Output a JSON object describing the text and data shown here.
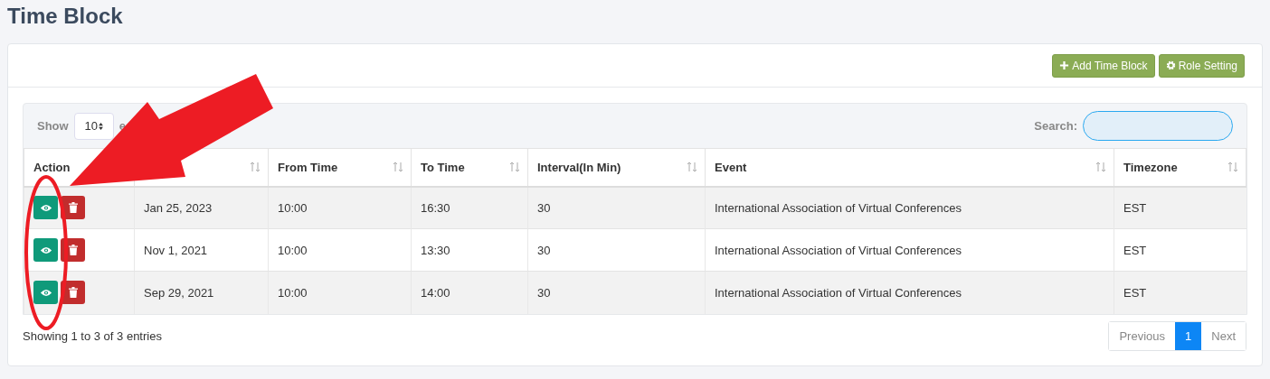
{
  "page": {
    "title": "Time Block"
  },
  "toolbar": {
    "buttons": [
      {
        "kind": "add",
        "label": "Add Time Block"
      },
      {
        "kind": "settings",
        "label": "Role Setting"
      }
    ]
  },
  "length_control": {
    "label": "Show",
    "value": "10",
    "suffix": "e"
  },
  "search": {
    "label": "Search:"
  },
  "table": {
    "columns": [
      {
        "label": "Action"
      },
      {
        "sortable": true
      },
      {
        "label": "From Time",
        "sortable": true
      },
      {
        "label": "To Time",
        "sortable": true
      },
      {
        "label": "Interval(In Min)",
        "sortable": true
      },
      {
        "label": "Event",
        "sortable": true
      },
      {
        "label": "Timezone",
        "sortable": true
      }
    ],
    "rows": [
      {
        "cells": [
          "",
          "Jan 25, 2023",
          "10:00",
          "16:30",
          "30",
          "International Association of Virtual Conferences",
          "EST"
        ]
      },
      {
        "cells": [
          "",
          "Nov 1, 2021",
          "10:00",
          "13:30",
          "30",
          "International Association of Virtual Conferences",
          "EST"
        ]
      },
      {
        "cells": [
          "",
          "Sep 29, 2021",
          "10:00",
          "14:00",
          "30",
          "International Association of Virtual Conferences",
          "EST"
        ]
      }
    ]
  },
  "info": "Showing 1 to 3 of 3 entries",
  "pagination": {
    "previous": "Previous",
    "pages": [
      {
        "label": "1",
        "selected": true
      }
    ],
    "next": "Next"
  }
}
